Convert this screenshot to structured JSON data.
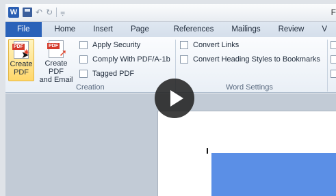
{
  "qat": {
    "app_icon_letter": "W",
    "title_fragment": "F"
  },
  "tabs": [
    {
      "label": "File"
    },
    {
      "label": "Home"
    },
    {
      "label": "Insert"
    },
    {
      "label": "Page Layout"
    },
    {
      "label": "References"
    },
    {
      "label": "Mailings"
    },
    {
      "label": "Review"
    },
    {
      "label": "V"
    }
  ],
  "ribbon": {
    "creation": {
      "create_pdf_line1": "Create",
      "create_pdf_line2": "PDF",
      "create_pdf_email_line1": "Create PDF",
      "create_pdf_email_line2": "and Email",
      "pdf_tag": "PDF",
      "checkboxes": [
        "Apply Security",
        "Comply With PDF/A-1b",
        "Tagged PDF"
      ],
      "label": "Creation"
    },
    "word_settings": {
      "checkboxes": [
        "Convert Links",
        "Convert Heading Styles to Bookmarks"
      ],
      "label": "Word Settings"
    }
  },
  "colors": {
    "file_tab": "#2a62b9",
    "highlight": "#ffd76a",
    "image_block": "#5b8fe6"
  }
}
